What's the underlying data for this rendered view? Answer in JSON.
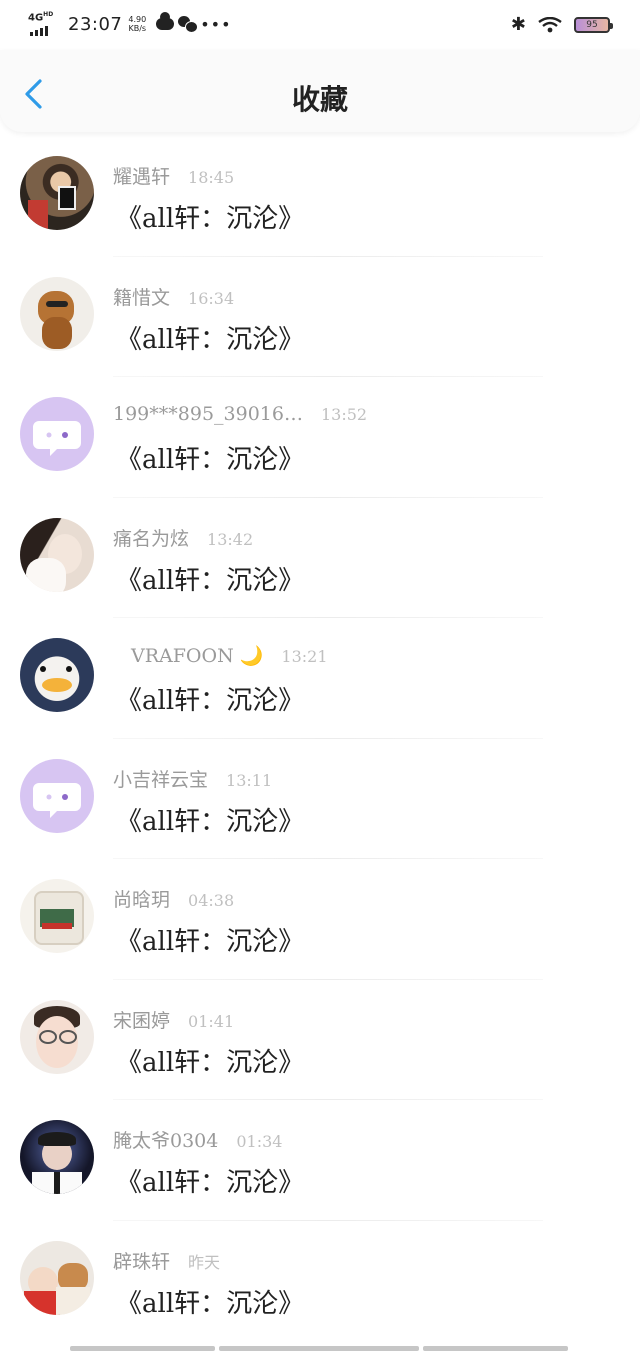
{
  "status_bar": {
    "network": "4G",
    "network_sup": "HD",
    "time": "23:07",
    "speed_value": "4.90",
    "speed_unit": "KB/s",
    "more": "•••",
    "bluetooth": "✱",
    "battery": "95"
  },
  "header": {
    "title": "收藏",
    "back_icon": "chevron-left-icon"
  },
  "colors": {
    "accent": "#2f9be8",
    "name_gray": "#9a9a9a",
    "default_avatar": "#d7c5f2"
  },
  "items": [
    {
      "name": "耀遇轩",
      "time": "18:45",
      "message": "《all轩：沉沦》",
      "avatar": "photo-boy"
    },
    {
      "name": "籍惜文",
      "time": "16:34",
      "message": "《all轩：沉沦》",
      "avatar": "photo-dog"
    },
    {
      "name": "199***895_39016…",
      "time": "13:52",
      "message": "《all轩：沉沦》",
      "avatar": "default-bubble"
    },
    {
      "name": "痛名为炫",
      "time": "13:42",
      "message": "《all轩：沉沦》",
      "avatar": "photo-girl"
    },
    {
      "name": "VRAFOON 🌙",
      "time": "13:21",
      "message": "《all轩：沉沦》",
      "avatar": "photo-duck"
    },
    {
      "name": "小吉祥云宝",
      "time": "13:11",
      "message": "《all轩：沉沦》",
      "avatar": "default-bubble"
    },
    {
      "name": "尚晗玥",
      "time": "04:38",
      "message": "《all轩：沉沦》",
      "avatar": "photo-mug"
    },
    {
      "name": "宋囷婷",
      "time": "01:41",
      "message": "《all轩：沉沦》",
      "avatar": "photo-glasses"
    },
    {
      "name": "腌太爷0304",
      "time": "01:34",
      "message": "《all轩：沉沦》",
      "avatar": "photo-suit"
    },
    {
      "name": "辟珠轩",
      "time": "昨天",
      "message": "《all轩：沉沦》",
      "avatar": "photo-baby"
    }
  ]
}
